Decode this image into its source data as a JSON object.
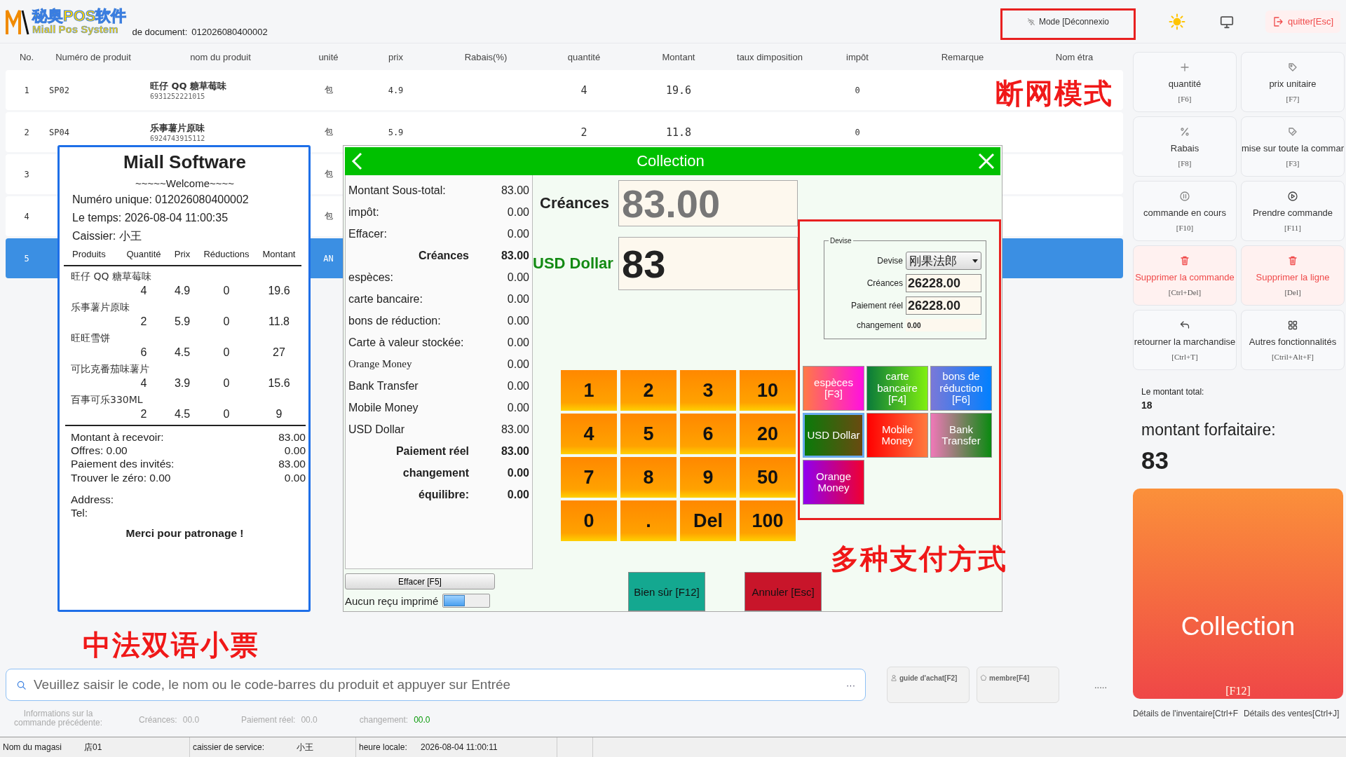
{
  "header": {
    "logo_cn": "秘奥POS软件",
    "logo_en": "Miall Pos System",
    "doc_label": "de document:",
    "doc_number": "012026080400002",
    "mode_button": "Mode [Déconnexio",
    "quit_button": "quitter[Esc]"
  },
  "table": {
    "columns": [
      "No.",
      "Numéro de produit",
      "nom du produit",
      "unité",
      "prix",
      "Rabais(%)",
      "quantité",
      "Montant",
      "taux dimposition",
      "impôt",
      "Remarque",
      "Nom étra"
    ],
    "rows": [
      {
        "no": "1",
        "code": "SP02",
        "name": "旺仔 QQ 糖草莓味",
        "barcode": "6931252221015",
        "unit": "包",
        "price": "4.9",
        "quantity": "4",
        "amount": "19.6",
        "tax": "0",
        "selected": false
      },
      {
        "no": "2",
        "code": "SP04",
        "name": "乐事薯片原味",
        "barcode": "6924743915112",
        "unit": "包",
        "price": "5.9",
        "quantity": "2",
        "amount": "11.8",
        "tax": "0",
        "selected": false
      },
      {
        "no": "3",
        "unit": "包",
        "selected": false
      },
      {
        "no": "4",
        "unit": "包",
        "selected": false
      },
      {
        "no": "5",
        "unit": "AN",
        "selected": true
      }
    ]
  },
  "receipt": {
    "title": "Miall Software",
    "welcome": "~~~~~Welcome~~~~",
    "info": [
      "Numéro unique: 012026080400002",
      "Le temps: 2026-08-04 11:00:35",
      "Caissier: 小王"
    ],
    "columns": [
      "Produits",
      "Quantité",
      "Prix",
      "Réductions",
      "Montant"
    ],
    "items": [
      {
        "name": "旺仔 QQ 糖草莓味",
        "values": [
          "4",
          "4.9",
          "0",
          "19.6"
        ]
      },
      {
        "name": "乐事薯片原味",
        "values": [
          "2",
          "5.9",
          "0",
          "11.8"
        ]
      },
      {
        "name": "旺旺雪饼",
        "values": [
          "6",
          "4.5",
          "0",
          "27"
        ]
      },
      {
        "name": "可比克番茄味薯片",
        "values": [
          "4",
          "3.9",
          "0",
          "15.6"
        ]
      },
      {
        "name": "百事可乐330ML",
        "values": [
          "2",
          "4.5",
          "0",
          "9"
        ]
      }
    ],
    "totals": [
      {
        "label": "Montant à recevoir:",
        "value": "83.00"
      },
      {
        "label": "Offres: 0.00",
        "value": "0.00"
      },
      {
        "label": "Paiement des invités:",
        "value": "83.00"
      },
      {
        "label": "Trouver le zéro: 0.00",
        "value": "0.00"
      }
    ],
    "address": "Address:",
    "tel": "Tel:",
    "thanks": "Merci pour patronage !"
  },
  "dialog": {
    "title": "Collection",
    "summary": [
      {
        "label": "Montant Sous-total:",
        "value": "83.00",
        "kind": "plain"
      },
      {
        "label": "impôt:",
        "value": "0.00",
        "kind": "plain"
      },
      {
        "label": "Effacer:",
        "value": "0.00",
        "kind": "plain"
      },
      {
        "label": "Créances",
        "value": "83.00",
        "kind": "total"
      },
      {
        "label": "espèces:",
        "value": "0.00",
        "kind": "plain"
      },
      {
        "label": "carte bancaire:",
        "value": "0.00",
        "kind": "plain"
      },
      {
        "label": "bons de réduction:",
        "value": "0.00",
        "kind": "plain"
      },
      {
        "label": "Carte à valeur stockée:",
        "value": "0.00",
        "kind": "plain"
      },
      {
        "label": "Orange Money",
        "value": "0.00",
        "kind": "serif"
      },
      {
        "label": "Bank Transfer",
        "value": "0.00",
        "kind": "plain"
      },
      {
        "label": "Mobile Money",
        "value": "0.00",
        "kind": "plain"
      },
      {
        "label": "USD Dollar",
        "value": "83.00",
        "kind": "plain"
      },
      {
        "label": "Paiement réel",
        "value": "83.00",
        "kind": "total"
      },
      {
        "label": "changement",
        "value": "0.00",
        "kind": "total"
      },
      {
        "label": "équilibre:",
        "value": "0.00",
        "kind": "total"
      }
    ],
    "due_label": "Créances",
    "due_value": "83.00",
    "currency_label": "USD Dollar",
    "paid_value": "83",
    "keypad": [
      "1",
      "2",
      "3",
      "10",
      "4",
      "5",
      "6",
      "20",
      "7",
      "8",
      "9",
      "50",
      "0",
      ".",
      "Del",
      "100"
    ],
    "currency_box": {
      "legend": "Devise",
      "currency_label": "Devise",
      "currency": "刚果法郎",
      "due_label": "Créances",
      "due": "26228.00",
      "paid_label": "Paiement réel",
      "paid": "26228.00",
      "change_label": "changement",
      "change": "0.00"
    },
    "methods": [
      {
        "label": "espèces",
        "shortcut": "[F3]",
        "selected": false
      },
      {
        "label": "carte bancaire",
        "shortcut": "[F4]",
        "selected": false
      },
      {
        "label": "bons de réduction",
        "shortcut": "[F6]",
        "selected": false
      },
      {
        "label": "USD Dollar",
        "selected": true
      },
      {
        "label": "Mobile Money",
        "selected": false
      },
      {
        "label": "Bank Transfer",
        "selected": false
      },
      {
        "label": "Orange Money",
        "selected": false
      }
    ],
    "clear_button": "Effacer [F5]",
    "no_receipt": {
      "label": "Aucun reçu imprimé",
      "on": false
    },
    "confirm_button": "Bien sûr [F12]",
    "cancel_button": "Annuler [Esc]"
  },
  "sidebar": {
    "actions": [
      {
        "label": "quantité",
        "shortcut": "[F6]",
        "kind": "normal"
      },
      {
        "label": "prix unitaire",
        "shortcut": "[F7]",
        "kind": "normal"
      },
      {
        "label": "Rabais",
        "shortcut": "[F8]",
        "kind": "normal"
      },
      {
        "label": "mise sur toute la commar",
        "shortcut": "[F3]",
        "kind": "normal"
      },
      {
        "label": "commande en cours",
        "shortcut": "[F10]",
        "kind": "normal"
      },
      {
        "label": "Prendre commande",
        "shortcut": "[F11]",
        "kind": "normal"
      },
      {
        "label": "Supprimer la commande",
        "shortcut": "[Ctrl+Del]",
        "kind": "danger"
      },
      {
        "label": "Supprimer la ligne",
        "shortcut": "[Del]",
        "kind": "danger"
      },
      {
        "label": "retourner la marchandise",
        "shortcut": "[Ctrl+T]",
        "kind": "normal"
      },
      {
        "label": "Autres fonctionnalités",
        "shortcut": "[Ctril+Alt+F]",
        "kind": "normal"
      }
    ],
    "total_label": "Le montant total:",
    "total_count": "18",
    "lump_label": "montant forfaitaire:",
    "lump_value": "83",
    "collect_button": {
      "label": "Collection",
      "shortcut": "[F12]"
    },
    "links": [
      "Détails de l'inventaire[Ctrl+F",
      "Détails des ventes[Ctrl+J]"
    ]
  },
  "search": {
    "placeholder": "Veuillez saisir le code, le nom ou le code-barres du produit et appuyer sur Entrée",
    "more": "···"
  },
  "bottom_buttons": [
    "guide d'achat[F2]",
    "membre[F4]"
  ],
  "more": ".....",
  "last_order": {
    "title": "Informations sur la commande précédente:",
    "fields": [
      {
        "label": "Créances:",
        "value": "00.0",
        "kind": "plain"
      },
      {
        "label": "Paiement réel:",
        "value": "00.0",
        "kind": "plain"
      },
      {
        "label": "changement:",
        "value": "00.0",
        "kind": "highlight"
      }
    ]
  },
  "status_bar": [
    {
      "label": "Nom du magasi",
      "value": "店01"
    },
    {
      "label": "caissier de service:",
      "value": "小王"
    },
    {
      "label": "heure locale:",
      "value": "2026-08-04 11:00:11"
    }
  ],
  "annotations": [
    "断网模式",
    "中法双语小票",
    "多种支付方式"
  ]
}
